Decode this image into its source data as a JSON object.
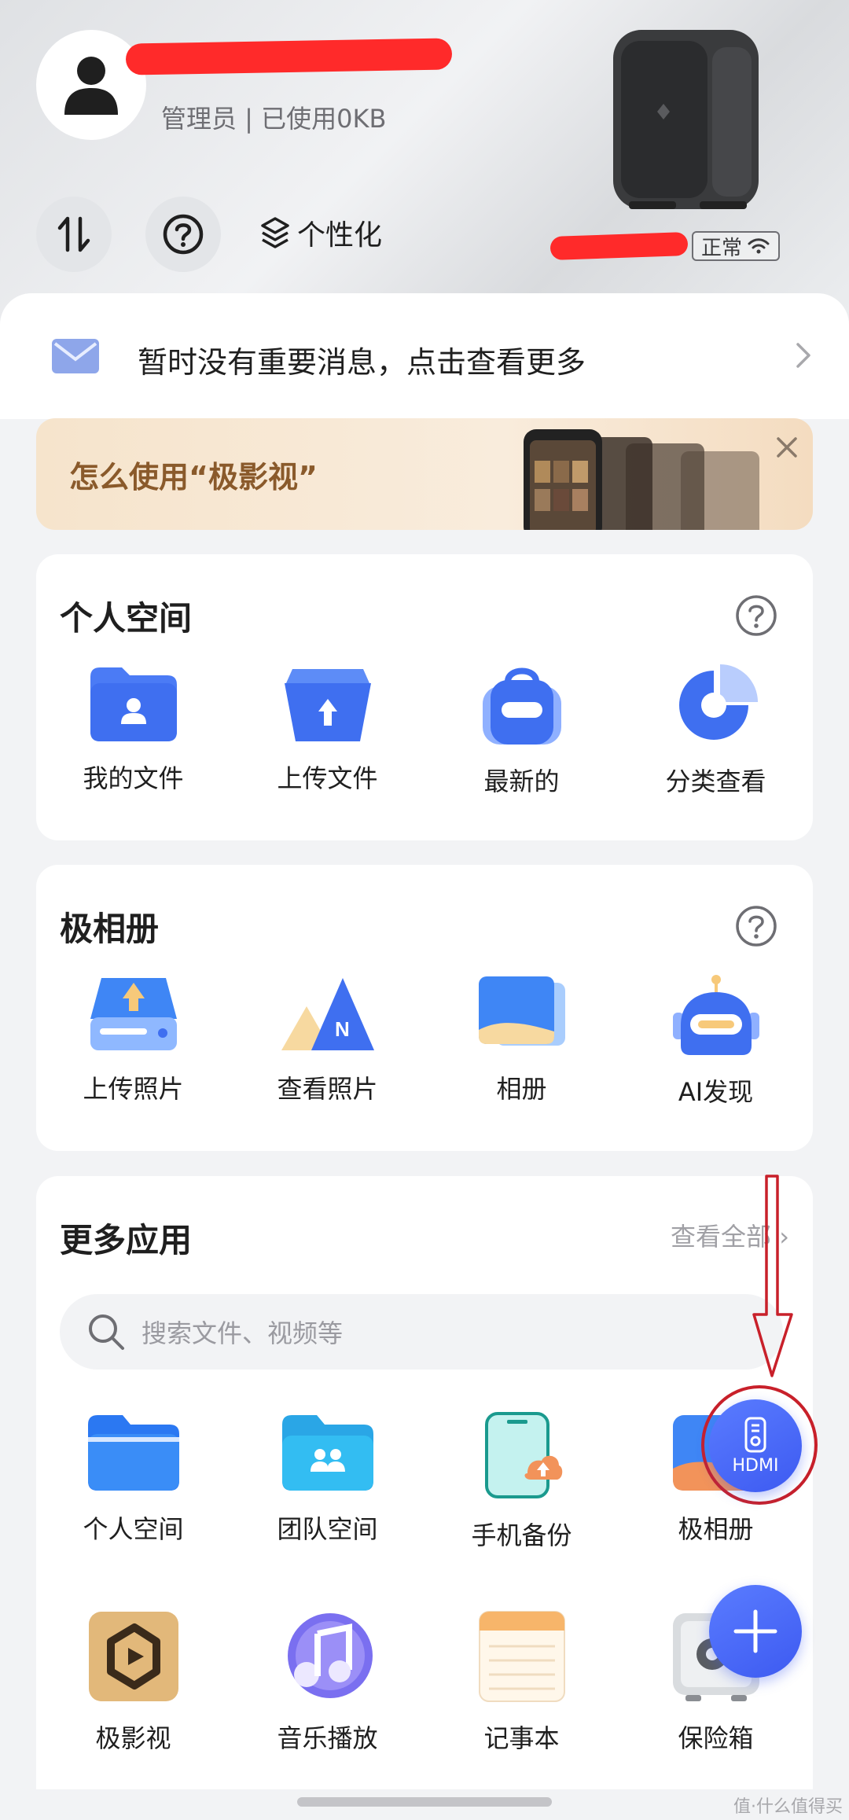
{
  "header": {
    "role_line": "管理员 | 已使用0KB",
    "personalize_label": "个性化",
    "device_status": "正常",
    "icons": [
      "user-icon",
      "transfer-icon",
      "help-icon",
      "layers-icon",
      "wifi-icon"
    ]
  },
  "message": {
    "text": "暂时没有重要消息，点击查看更多"
  },
  "banner": {
    "text": "怎么使用“极影视”"
  },
  "personal_space": {
    "title": "个人空间",
    "items": [
      {
        "label": "我的文件",
        "icon": "folder-user-icon"
      },
      {
        "label": "上传文件",
        "icon": "upload-icon"
      },
      {
        "label": "最新的",
        "icon": "bag-icon"
      },
      {
        "label": "分类查看",
        "icon": "pie-icon"
      }
    ]
  },
  "album": {
    "title": "极相册",
    "items": [
      {
        "label": "上传照片",
        "icon": "upload-drive-icon"
      },
      {
        "label": "查看照片",
        "icon": "mountain-icon"
      },
      {
        "label": "相册",
        "icon": "photo-stack-icon"
      },
      {
        "label": "AI发现",
        "icon": "robot-icon"
      }
    ]
  },
  "more_apps": {
    "title": "更多应用",
    "see_all": "查看全部",
    "search_placeholder": "搜索文件、视频等",
    "row1": [
      {
        "label": "个人空间",
        "icon": "folder-icon"
      },
      {
        "label": "团队空间",
        "icon": "team-folder-icon"
      },
      {
        "label": "手机备份",
        "icon": "phone-backup-icon"
      },
      {
        "label": "极相册",
        "icon": "album-icon"
      }
    ],
    "row2": [
      {
        "label": "极影视",
        "icon": "video-icon"
      },
      {
        "label": "音乐播放",
        "icon": "music-icon"
      },
      {
        "label": "记事本",
        "icon": "notepad-icon"
      },
      {
        "label": "保险箱",
        "icon": "safe-icon"
      }
    ]
  },
  "fab": {
    "hdmi_label": "HDMI"
  },
  "watermark": "值·什么值得买"
}
